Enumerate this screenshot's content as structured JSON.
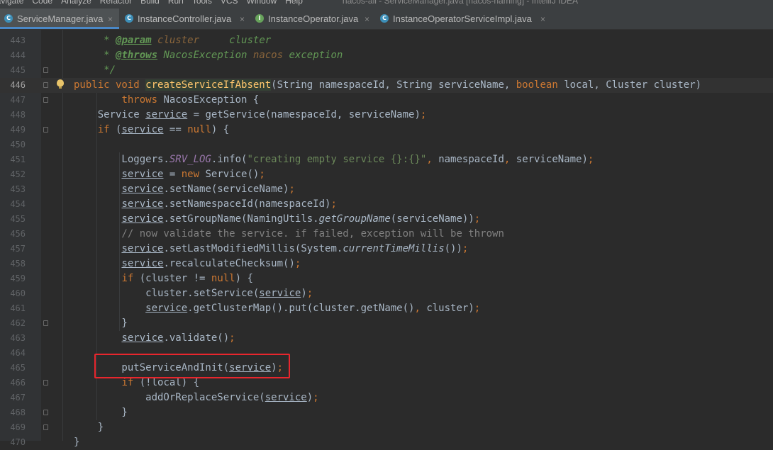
{
  "menubar": {
    "items": [
      "Navigate",
      "Code",
      "Analyze",
      "Refactor",
      "Build",
      "Run",
      "Tools",
      "VCS",
      "Window",
      "Help"
    ],
    "window_title": "nacos-all - ServiceManager.java [nacos-naming] - IntelliJ IDEA"
  },
  "tabs": [
    {
      "label": "ServiceManager.java",
      "icon": "java-class-icon",
      "active": true,
      "close": "×"
    },
    {
      "label": "InstanceController.java",
      "icon": "java-class-icon",
      "active": false,
      "close": "×"
    },
    {
      "label": "InstanceOperator.java",
      "icon": "java-interface-icon",
      "active": false,
      "close": "×"
    },
    {
      "label": "InstanceOperatorServiceImpl.java",
      "icon": "java-class-icon",
      "active": false,
      "close": "×"
    }
  ],
  "editor": {
    "current_line": "446",
    "lines": [
      {
        "n": "443",
        "code": [
          {
            "t": "     * ",
            "c": "comment"
          },
          {
            "t": "@param",
            "c": "doc-tag"
          },
          {
            "t": " cluster",
            "c": "doc-param"
          },
          {
            "t": "     cluster",
            "c": "comment"
          }
        ]
      },
      {
        "n": "444",
        "code": [
          {
            "t": "     * ",
            "c": "comment"
          },
          {
            "t": "@throws",
            "c": "doc-tag"
          },
          {
            "t": " NacosException ",
            "c": "comment"
          },
          {
            "t": "nacos",
            "c": "doc-param"
          },
          {
            "t": " exception",
            "c": "comment"
          }
        ]
      },
      {
        "n": "445",
        "code": [
          {
            "t": "     */",
            "c": "comment"
          }
        ]
      },
      {
        "n": "446",
        "code": [
          {
            "t": "public void ",
            "c": "kw"
          },
          {
            "t": "createServiceIfAbsent",
            "c": "fn-decl"
          },
          {
            "t": "(String namespaceId, String serviceName, ",
            "c": ""
          },
          {
            "t": "boolean ",
            "c": "kw"
          },
          {
            "t": "local, Cluster cluster)",
            "c": ""
          }
        ]
      },
      {
        "n": "447",
        "code": [
          {
            "t": "        ",
            "c": ""
          },
          {
            "t": "throws ",
            "c": "kw"
          },
          {
            "t": "NacosException {",
            "c": ""
          }
        ]
      },
      {
        "n": "448",
        "code": [
          {
            "t": "    Service ",
            "c": ""
          },
          {
            "t": "service",
            "c": "ul"
          },
          {
            "t": " = getService(namespaceId, serviceName)",
            "c": ""
          },
          {
            "t": ";",
            "c": "kw"
          }
        ]
      },
      {
        "n": "449",
        "code": [
          {
            "t": "    ",
            "c": ""
          },
          {
            "t": "if ",
            "c": "kw"
          },
          {
            "t": "(",
            "c": ""
          },
          {
            "t": "service",
            "c": "ul"
          },
          {
            "t": " == ",
            "c": ""
          },
          {
            "t": "null",
            "c": "kw"
          },
          {
            "t": ") {",
            "c": ""
          }
        ]
      },
      {
        "n": "450",
        "code": []
      },
      {
        "n": "451",
        "code": [
          {
            "t": "        Loggers.",
            "c": ""
          },
          {
            "t": "SRV_LOG",
            "c": "static-field"
          },
          {
            "t": ".info(",
            "c": ""
          },
          {
            "t": "\"creating empty service {}:{}\"",
            "c": "str"
          },
          {
            "t": ", ",
            "c": "kw"
          },
          {
            "t": "namespaceId",
            "c": ""
          },
          {
            "t": ", ",
            "c": "kw"
          },
          {
            "t": "serviceName)",
            "c": ""
          },
          {
            "t": ";",
            "c": "kw"
          }
        ]
      },
      {
        "n": "452",
        "code": [
          {
            "t": "        ",
            "c": ""
          },
          {
            "t": "service",
            "c": "ul"
          },
          {
            "t": " = ",
            "c": ""
          },
          {
            "t": "new ",
            "c": "kw"
          },
          {
            "t": "Service()",
            "c": ""
          },
          {
            "t": ";",
            "c": "kw"
          }
        ]
      },
      {
        "n": "453",
        "code": [
          {
            "t": "        ",
            "c": ""
          },
          {
            "t": "service",
            "c": "ul"
          },
          {
            "t": ".setName(serviceName)",
            "c": ""
          },
          {
            "t": ";",
            "c": "kw"
          }
        ]
      },
      {
        "n": "454",
        "code": [
          {
            "t": "        ",
            "c": ""
          },
          {
            "t": "service",
            "c": "ul"
          },
          {
            "t": ".setNamespaceId(namespaceId)",
            "c": ""
          },
          {
            "t": ";",
            "c": "kw"
          }
        ]
      },
      {
        "n": "455",
        "code": [
          {
            "t": "        ",
            "c": ""
          },
          {
            "t": "service",
            "c": "ul"
          },
          {
            "t": ".setGroupName(NamingUtils.",
            "c": ""
          },
          {
            "t": "getGroupName",
            "c": "italic"
          },
          {
            "t": "(serviceName))",
            "c": ""
          },
          {
            "t": ";",
            "c": "kw"
          }
        ]
      },
      {
        "n": "456",
        "code": [
          {
            "t": "        // now validate the service. if failed, exception will be thrown",
            "c": "line-comment"
          }
        ]
      },
      {
        "n": "457",
        "code": [
          {
            "t": "        ",
            "c": ""
          },
          {
            "t": "service",
            "c": "ul"
          },
          {
            "t": ".setLastModifiedMillis(System.",
            "c": ""
          },
          {
            "t": "currentTimeMillis",
            "c": "italic"
          },
          {
            "t": "())",
            "c": ""
          },
          {
            "t": ";",
            "c": "kw"
          }
        ]
      },
      {
        "n": "458",
        "code": [
          {
            "t": "        ",
            "c": ""
          },
          {
            "t": "service",
            "c": "ul"
          },
          {
            "t": ".recalculateChecksum()",
            "c": ""
          },
          {
            "t": ";",
            "c": "kw"
          }
        ]
      },
      {
        "n": "459",
        "code": [
          {
            "t": "        ",
            "c": ""
          },
          {
            "t": "if ",
            "c": "kw"
          },
          {
            "t": "(cluster != ",
            "c": ""
          },
          {
            "t": "null",
            "c": "kw"
          },
          {
            "t": ") {",
            "c": ""
          }
        ]
      },
      {
        "n": "460",
        "code": [
          {
            "t": "            cluster.setService(",
            "c": ""
          },
          {
            "t": "service",
            "c": "ul"
          },
          {
            "t": ")",
            "c": ""
          },
          {
            "t": ";",
            "c": "kw"
          }
        ]
      },
      {
        "n": "461",
        "code": [
          {
            "t": "            ",
            "c": ""
          },
          {
            "t": "service",
            "c": "ul"
          },
          {
            "t": ".getClusterMap().put(cluster.getName()",
            "c": ""
          },
          {
            "t": ", ",
            "c": "kw"
          },
          {
            "t": "cluster)",
            "c": ""
          },
          {
            "t": ";",
            "c": "kw"
          }
        ]
      },
      {
        "n": "462",
        "code": [
          {
            "t": "        }",
            "c": ""
          }
        ]
      },
      {
        "n": "463",
        "code": [
          {
            "t": "        ",
            "c": ""
          },
          {
            "t": "service",
            "c": "ul"
          },
          {
            "t": ".validate()",
            "c": ""
          },
          {
            "t": ";",
            "c": "kw"
          }
        ]
      },
      {
        "n": "464",
        "code": []
      },
      {
        "n": "465",
        "code": [
          {
            "t": "        putServiceAndInit(",
            "c": ""
          },
          {
            "t": "service",
            "c": "ul"
          },
          {
            "t": ")",
            "c": ""
          },
          {
            "t": ";",
            "c": "kw"
          }
        ]
      },
      {
        "n": "466",
        "code": [
          {
            "t": "        ",
            "c": ""
          },
          {
            "t": "if ",
            "c": "kw"
          },
          {
            "t": "(!local) {",
            "c": ""
          }
        ]
      },
      {
        "n": "467",
        "code": [
          {
            "t": "            addOrReplaceService(",
            "c": ""
          },
          {
            "t": "service",
            "c": "ul"
          },
          {
            "t": ")",
            "c": ""
          },
          {
            "t": ";",
            "c": "kw"
          }
        ]
      },
      {
        "n": "468",
        "code": [
          {
            "t": "        }",
            "c": ""
          }
        ]
      },
      {
        "n": "469",
        "code": [
          {
            "t": "    }",
            "c": ""
          }
        ]
      },
      {
        "n": "470",
        "code": [
          {
            "t": "}",
            "c": ""
          }
        ]
      }
    ],
    "fold_lines": [
      "445",
      "446",
      "447",
      "449",
      "462",
      "466",
      "468",
      "469"
    ],
    "highlighted_line": "465"
  },
  "colors": {
    "keyword": "#cc7832",
    "method_declaration": "#ffc66d",
    "string": "#6a8759",
    "doc_comment": "#629755",
    "line_comment": "#808080",
    "static_field": "#9876aa",
    "highlight_box": "#e8262d",
    "active_tab_underline": "#4a88c7"
  }
}
